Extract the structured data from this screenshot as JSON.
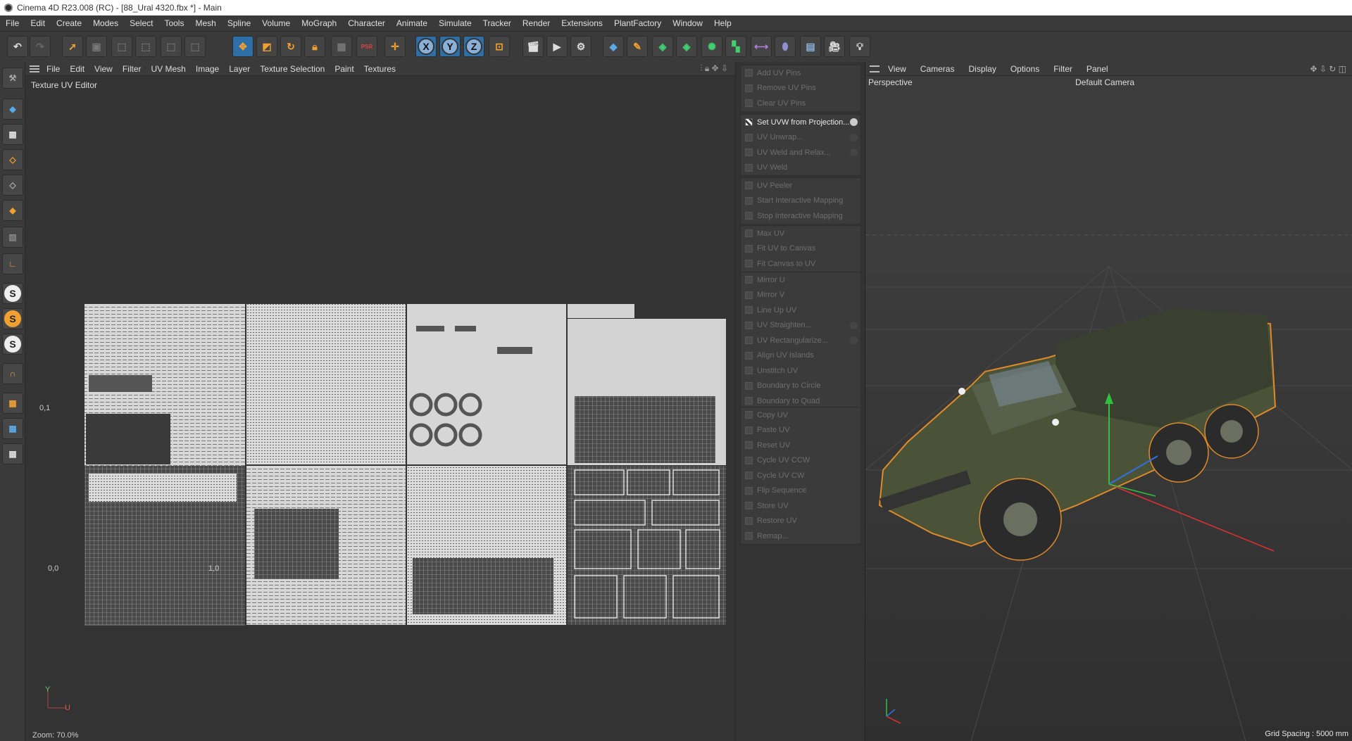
{
  "window": {
    "title": "Cinema 4D R23.008 (RC) - [88_Ural 4320.fbx *] - Main"
  },
  "menubar": [
    "File",
    "Edit",
    "Create",
    "Modes",
    "Select",
    "Tools",
    "Mesh",
    "Spline",
    "Volume",
    "MoGraph",
    "Character",
    "Animate",
    "Simulate",
    "Tracker",
    "Render",
    "Extensions",
    "PlantFactory",
    "Window",
    "Help"
  ],
  "toolbar": {
    "axis_x": "X",
    "axis_y": "Y",
    "axis_z": "Z",
    "psr_label": "PSR"
  },
  "uv_editor": {
    "menu": [
      "File",
      "Edit",
      "View",
      "Filter",
      "UV Mesh",
      "Image",
      "Layer",
      "Texture Selection",
      "Paint",
      "Textures"
    ],
    "title": "Texture UV Editor",
    "axis_label_01": "0,1",
    "axis_label_00": "0,0",
    "axis_label_10": "1,0",
    "axis_y": "Y",
    "axis_u": "U",
    "zoom": "Zoom: 70.0%"
  },
  "uv_commands": {
    "groups": [
      [
        "Add UV Pins",
        "Remove UV Pins",
        "Clear UV Pins"
      ],
      [
        "Set UVW from Projection...",
        "UV Unwrap...",
        "UV Weld and Relax...",
        "UV Weld"
      ],
      [
        "UV Peeler",
        "Start Interactive Mapping",
        "Stop Interactive Mapping"
      ],
      [
        "Max UV",
        "Fit UV to Canvas",
        "Fit Canvas to UV"
      ],
      [
        "Mirror U",
        "Mirror V",
        "Line Up UV",
        "UV Straighten...",
        "UV Rectangularize...",
        "Align UV Islands",
        "Unstitch UV",
        "Boundary to Circle",
        "Boundary to Quad"
      ],
      [
        "Copy UV",
        "Paste UV",
        "Reset UV",
        "Cycle UV CCW",
        "Cycle UV CW",
        "Flip Sequence",
        "Store UV",
        "Restore UV",
        "Remap..."
      ]
    ],
    "active_item": "Set UVW from Projection..."
  },
  "viewport": {
    "menu": [
      "View",
      "Cameras",
      "Display",
      "Options",
      "Filter",
      "Panel"
    ],
    "view_name": "Perspective",
    "camera": "Default Camera",
    "grid_spacing": "Grid Spacing : 5000 mm"
  },
  "colors": {
    "background": "#333333",
    "accent_orange": "#f0a030",
    "selection_outline": "#e08a2a",
    "axis_x": "#e03030",
    "axis_y": "#30c040",
    "axis_z": "#3070e0",
    "truck_green": "#4a5238"
  }
}
